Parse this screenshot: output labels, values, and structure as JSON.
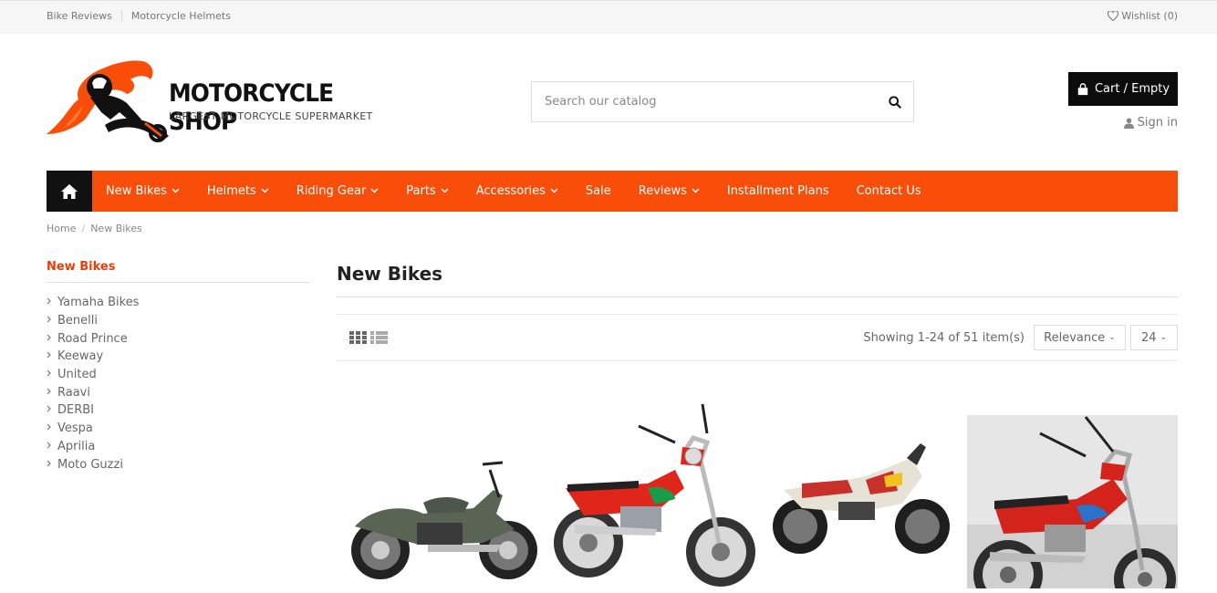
{
  "topbar": {
    "links": [
      "Bike Reviews",
      "Motorcycle Helmets"
    ],
    "wishlist": "Wishlist (0)"
  },
  "logo": {
    "title": "MOTORCYCLE SHOP",
    "subtitle": "LARGEST MOTORCYCLE SUPERMARKET"
  },
  "search": {
    "placeholder": "Search our catalog"
  },
  "cart": {
    "label": "Cart / Empty"
  },
  "account": {
    "signin": "Sign in"
  },
  "nav": {
    "items": [
      {
        "label": "New Bikes",
        "dropdown": true
      },
      {
        "label": "Helmets",
        "dropdown": true
      },
      {
        "label": "Riding Gear",
        "dropdown": true
      },
      {
        "label": "Parts",
        "dropdown": true
      },
      {
        "label": "Accessories",
        "dropdown": true
      },
      {
        "label": "Sale",
        "dropdown": false
      },
      {
        "label": "Reviews",
        "dropdown": true
      },
      {
        "label": "Installment Plans",
        "dropdown": false
      },
      {
        "label": "Contact Us",
        "dropdown": false
      }
    ]
  },
  "breadcrumb": [
    "Home",
    "New Bikes"
  ],
  "sidebar": {
    "title": "New Bikes",
    "items": [
      "Yamaha Bikes",
      "Benelli",
      "Road Prince",
      "Keeway",
      "United",
      "Raavi",
      "DERBI",
      "Vespa",
      "Aprilia",
      "Moto Guzzi"
    ]
  },
  "main": {
    "title": "New Bikes",
    "count": "Showing 1-24 of 51 item(s)",
    "sort": "Relevance",
    "per_page": "24"
  },
  "colors": {
    "accent": "#f94e0a",
    "dark": "#0c0c0c"
  },
  "products": [
    {
      "icon": "cruiser-motorcycle-image"
    },
    {
      "icon": "red-standard-motorcycle-image"
    },
    {
      "icon": "adventure-motorcycle-image"
    },
    {
      "icon": "red-standard-motorcycle-photo"
    }
  ]
}
